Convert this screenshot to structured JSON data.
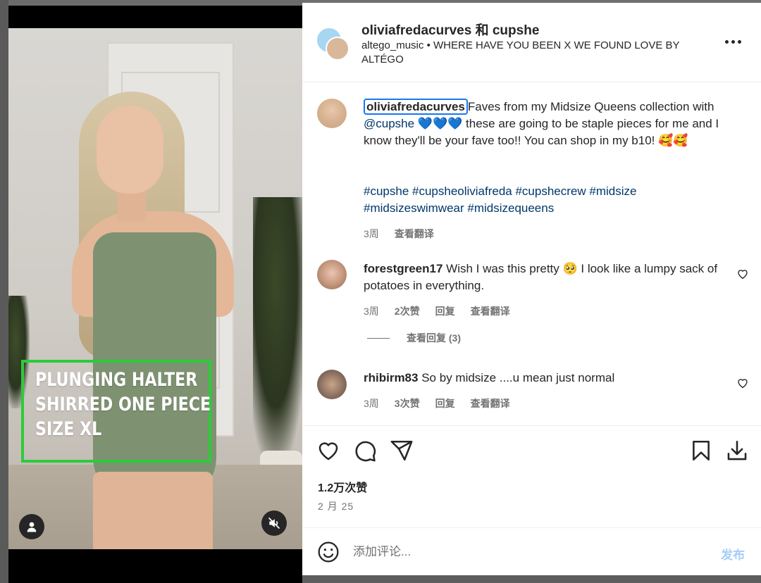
{
  "video": {
    "overlay_text": [
      "PLUNGING HALTER",
      "SHIRRED ONE PIECE",
      "SIZE XL"
    ],
    "highlight_color": "#2bcc3a",
    "buttons": {
      "profile_icon": "person-icon",
      "mute_icon": "speaker-muted-icon"
    }
  },
  "header": {
    "title": "oliviafredacurves 和 cupshe",
    "audio_user": "altego_music",
    "separator": "•",
    "audio_track": "WHERE HAVE YOU BEEN X WE FOUND LOVE BY ALTÉGO",
    "more_icon": "more-horizontal-icon"
  },
  "caption": {
    "username": "oliviafredacurves",
    "text_1": "Faves from my Midsize Queens collection with ",
    "mention": "@cupshe",
    "hearts": " 💙💙💙",
    "text_2": " these are going to be staple pieces for me and I know they'll be your fave too!! You can shop in my b10! 🥰🥰",
    "hashtags_line1": "#cupshe #cupsheoliviafreda #cupshecrew #midsize",
    "hashtags_line2": "#midsizeswimwear #midsizequeens",
    "time": "3周",
    "translate": "查看翻译"
  },
  "comments": [
    {
      "username": "forestgreen17",
      "text": "Wish I was this pretty 🥺 I look like a lumpy sack of potatoes in everything.",
      "time": "3周",
      "likes": "2次赞",
      "reply": "回复",
      "translate": "查看翻译"
    },
    {
      "username": "rhibirm83",
      "text": "So by midsize ....u mean just normal",
      "time": "3周",
      "likes": "3次赞",
      "reply": "回复",
      "translate": "查看翻译"
    }
  ],
  "view_replies": "查看回复 (3)",
  "actions": {
    "like_icon": "heart-icon",
    "comment_icon": "comment-icon",
    "share_icon": "send-icon",
    "save_icon": "bookmark-icon",
    "download_icon": "download-icon",
    "likes_count": "1.2万次赞",
    "date": "2 月 25"
  },
  "comment_bar": {
    "emoji_icon": "emoji-icon",
    "placeholder": "添加评论...",
    "post_label": "发布",
    "post_color": "#a6cdf7"
  }
}
